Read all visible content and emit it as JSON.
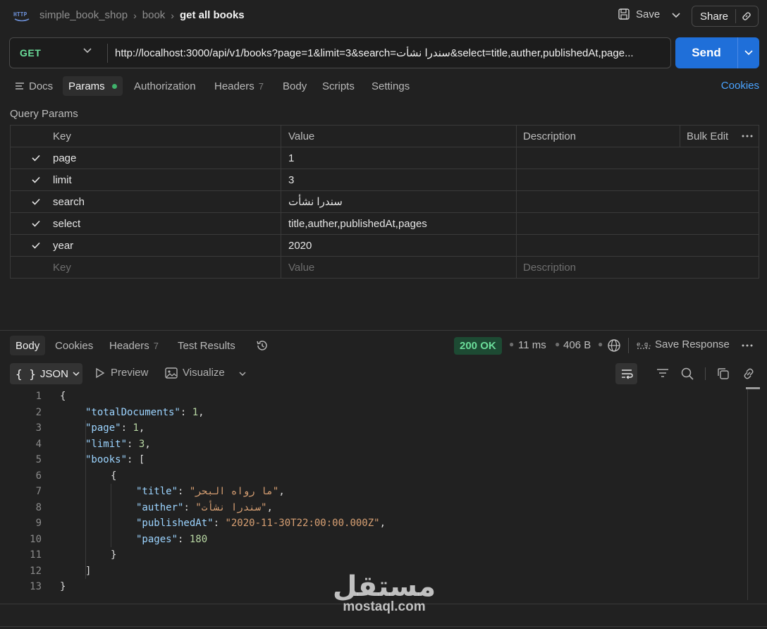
{
  "header": {
    "breadcrumb": [
      "simple_book_shop",
      "book",
      "get all books"
    ],
    "save_label": "Save",
    "share_label": "Share"
  },
  "request": {
    "method": "GET",
    "url": "http://localhost:3000/api/v1/books?page=1&limit=3&search=سندرا نشأت&select=title,auther,publishedAt,page...",
    "send_label": "Send"
  },
  "request_tabs": {
    "docs": "Docs",
    "params": "Params",
    "authorization": "Authorization",
    "headers": "Headers",
    "headers_count": "7",
    "body": "Body",
    "scripts": "Scripts",
    "settings": "Settings",
    "cookies": "Cookies"
  },
  "query_params": {
    "title": "Query Params",
    "columns": {
      "key": "Key",
      "value": "Value",
      "description": "Description",
      "bulk_edit": "Bulk Edit"
    },
    "rows": [
      {
        "key": "page",
        "value": "1",
        "checked": true
      },
      {
        "key": "limit",
        "value": "3",
        "checked": true
      },
      {
        "key": "search",
        "value": "سندرا نشأت",
        "checked": true
      },
      {
        "key": "select",
        "value": "title,auther,publishedAt,pages",
        "checked": true
      },
      {
        "key": "year",
        "value": "2020",
        "checked": true
      }
    ],
    "placeholders": {
      "key": "Key",
      "value": "Value",
      "description": "Description"
    }
  },
  "response": {
    "tabs": {
      "body": "Body",
      "cookies": "Cookies",
      "headers": "Headers",
      "headers_count": "7",
      "test_results": "Test Results"
    },
    "status": "200 OK",
    "time": "11 ms",
    "size": "406 B",
    "save_response": "Save Response",
    "format": "JSON",
    "preview": "Preview",
    "visualize": "Visualize"
  },
  "code": {
    "line_numbers": [
      "1",
      "2",
      "3",
      "4",
      "5",
      "6",
      "7",
      "8",
      "9",
      "10",
      "11",
      "12",
      "13"
    ],
    "open_brace": "{",
    "close_brace": "}",
    "total_key": "\"totalDocuments\"",
    "total_val": "1",
    "page_key": "\"page\"",
    "page_val": "1",
    "limit_key": "\"limit\"",
    "limit_val": "3",
    "books_key": "\"books\"",
    "books_open": "[",
    "books_close": "]",
    "obj_open": "{",
    "obj_close": "}",
    "title_key": "\"title\"",
    "title_val": "\"ما رواه البحر\"",
    "auther_key": "\"auther\"",
    "auther_val": "\"سندرا نشأت\"",
    "published_key": "\"publishedAt\"",
    "published_val": "\"2020-11-30T22:00:00.000Z\"",
    "pages_key": "\"pages\"",
    "pages_val": "180"
  },
  "watermark": {
    "arabic": "مستقل",
    "latin": "mostaql.com"
  }
}
